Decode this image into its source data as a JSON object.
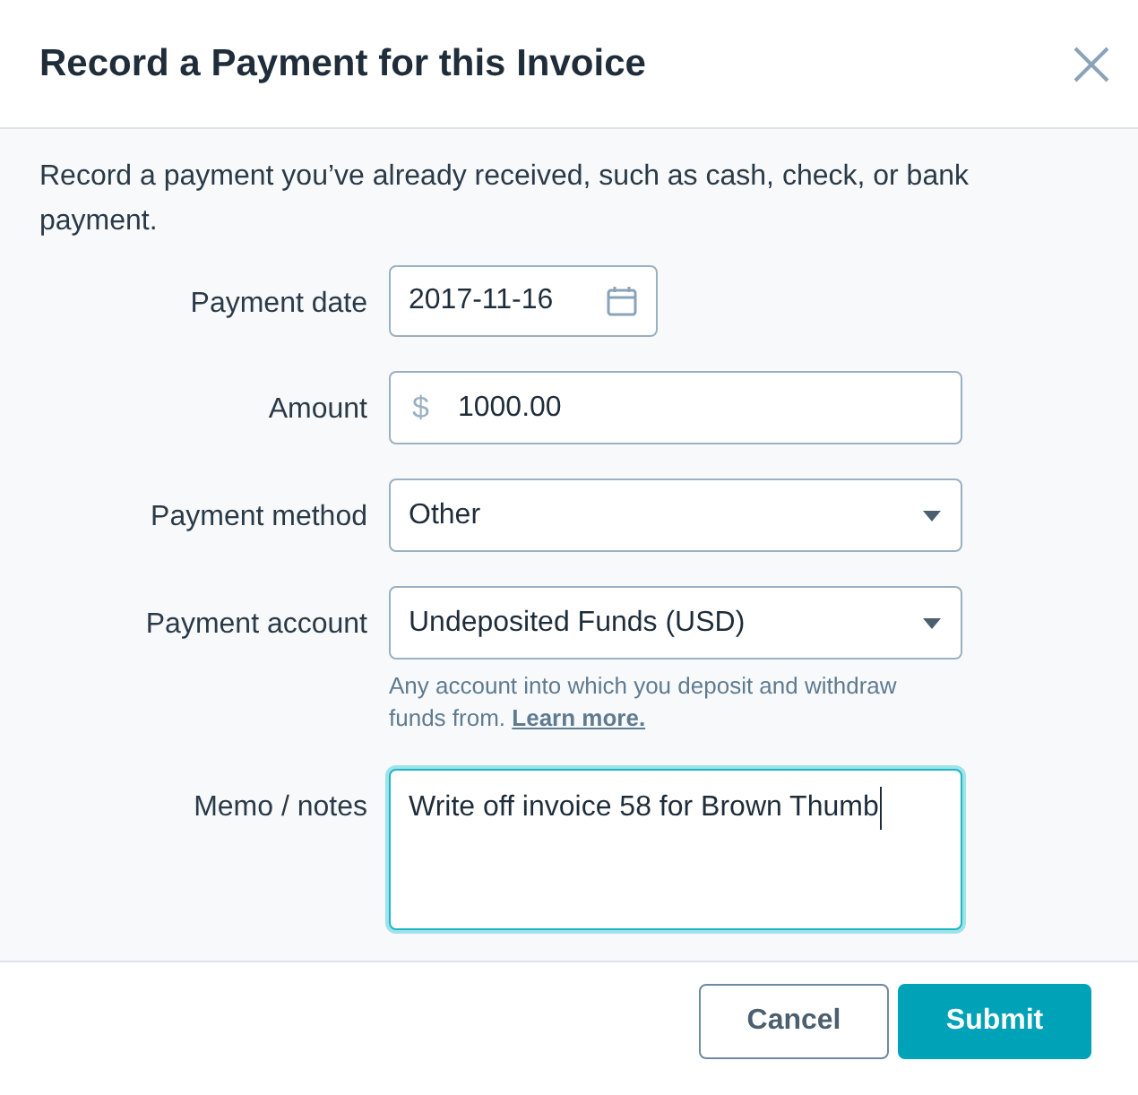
{
  "dialog": {
    "title": "Record a Payment for this Invoice",
    "description": "Record a payment you’ve already received, such as cash, check, or bank payment."
  },
  "fields": [
    {
      "kind": "date",
      "label": "Payment date",
      "value": "2017-11-16",
      "focused": false
    },
    {
      "kind": "currency",
      "label": "Amount",
      "prefix": "$",
      "value": "1000.00",
      "focused": false
    },
    {
      "kind": "select",
      "label": "Payment method",
      "value": "Other",
      "focused": false
    },
    {
      "kind": "select",
      "label": "Payment account",
      "value": "Undeposited Funds (USD)",
      "focused": false,
      "help": "Any account into which you deposit and withdraw funds from.",
      "help_link": "Learn more."
    },
    {
      "kind": "textarea",
      "label": "Memo / notes",
      "value": "Write off invoice 58 for Brown Thumb",
      "focused": true
    }
  ],
  "buttons": {
    "cancel": "Cancel",
    "submit": "Submit"
  }
}
